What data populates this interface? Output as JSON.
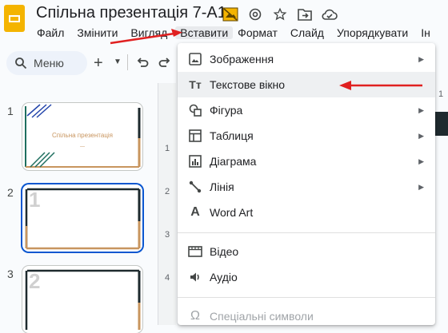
{
  "header": {
    "title": "Спільна презентація 7-А1",
    "icons": [
      "slides-logo-icon",
      "not-synced-icon",
      "at-sign-icon",
      "star-icon",
      "move-folder-icon",
      "cloud-status-icon"
    ]
  },
  "menubar": {
    "items": [
      "Файл",
      "Змінити",
      "Вигляд",
      "Вставити",
      "Формат",
      "Слайд",
      "Упорядкувати",
      "Ін"
    ],
    "active": "Вставити"
  },
  "toolbar": {
    "search_label": "Меню",
    "icons": [
      "search-icon",
      "plus-icon",
      "caret-down-icon",
      "undo-icon",
      "redo-icon"
    ]
  },
  "ruler": {
    "vertical_ticks": [
      "1",
      "2",
      "3",
      "4"
    ],
    "horizontal_tick": "1"
  },
  "slides": [
    {
      "num": "1",
      "title": "Спільна презентація",
      "caption": "—"
    },
    {
      "num": "2",
      "placeholder": "1"
    },
    {
      "num": "3",
      "placeholder": "2"
    }
  ],
  "insert_menu": {
    "items": [
      {
        "label": "Зображення",
        "icon": "image-icon",
        "submenu": true
      },
      {
        "label": "Текстове вікно",
        "icon": "text-box-icon",
        "submenu": false
      },
      {
        "label": "Фігура",
        "icon": "shape-icon",
        "submenu": true
      },
      {
        "label": "Таблиця",
        "icon": "table-icon",
        "submenu": true
      },
      {
        "label": "Діаграма",
        "icon": "chart-icon",
        "submenu": true
      },
      {
        "label": "Лінія",
        "icon": "line-icon",
        "submenu": true
      },
      {
        "label": "Word Art",
        "icon": "word-art-icon",
        "submenu": false
      },
      {
        "label": "Відео",
        "icon": "video-icon",
        "submenu": false
      },
      {
        "label": "Аудіо",
        "icon": "audio-icon",
        "submenu": false
      },
      {
        "label": "Спеціальні символи",
        "icon": "omega-icon",
        "submenu": false,
        "disabled": true
      }
    ],
    "highlighted": "Текстове вікно"
  },
  "annotations": {
    "arrow_color": "#e02020"
  },
  "colors": {
    "accent_blue": "#0b57d0",
    "logo_yellow": "#f4b400",
    "menu_bg": "#ffffff"
  }
}
